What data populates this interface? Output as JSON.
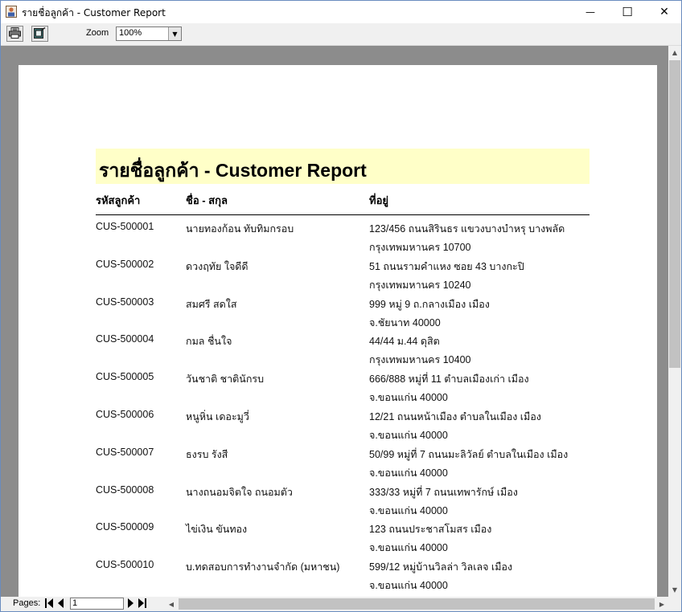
{
  "window": {
    "title": "รายชื่อลูกค้า - Customer Report",
    "icon": "report-app-icon",
    "controls": {
      "minimize": "—",
      "maximize": "☐",
      "close": "✕"
    }
  },
  "toolbar": {
    "print_icon": "print-icon",
    "export_icon": "export-icon",
    "zoom_label": "Zoom",
    "zoom_value": "100%"
  },
  "report": {
    "title": "รายชื่อลูกค้า - Customer Report",
    "title_background": "#ffffc8",
    "columns": {
      "id": "รหัสลูกค้า",
      "name": "ชื่อ - สกุล",
      "address": "ที่อยู่"
    },
    "rows": [
      {
        "id": "CUS-500001",
        "name": "นายทองก้อน ทับทิมกรอบ",
        "addr1": "123/456 ถนนสิรินธร แขวงบางบำหรุ  บางพลัด",
        "addr2": "กรุงเทพมหานคร  10700"
      },
      {
        "id": "CUS-500002",
        "name": "ดวงฤทัย ใจดีดี",
        "addr1": "51 ถนนรามคำแหง ซอย 43  บางกะปิ",
        "addr2": "กรุงเทพมหานคร  10240"
      },
      {
        "id": "CUS-500003",
        "name": "สมศรี สดใส",
        "addr1": "999 หมู่ 9 ถ.กลางเมือง  เมือง",
        "addr2": "จ.ชัยนาท  40000"
      },
      {
        "id": "CUS-500004",
        "name": "กมล ชื่นใจ",
        "addr1": "44/44 ม.44  ดุสิต",
        "addr2": "กรุงเทพมหานคร  10400"
      },
      {
        "id": "CUS-500005",
        "name": "วันชาติ ชาตินักรบ",
        "addr1": "666/888 หมู่ที่ 11 ตำบลเมืองเก่า  เมือง",
        "addr2": "จ.ขอนแก่น  40000"
      },
      {
        "id": "CUS-500006",
        "name": "หนูหิ่น เดอะมูวี่",
        "addr1": "12/21 ถนนหน้าเมือง ตำบลในเมือง  เมือง",
        "addr2": "จ.ขอนแก่น  40000"
      },
      {
        "id": "CUS-500007",
        "name": "ธงรบ รังสี",
        "addr1": "50/99 หมู่ที่ 7 ถนนมะลิวัลย์ ตำบลในเมือง  เมือง",
        "addr2": "จ.ขอนแก่น  40000"
      },
      {
        "id": "CUS-500008",
        "name": "นางถนอมจิตใจ ถนอมตัว",
        "addr1": "333/33 หมู่ที่ 7 ถนนเทพารักษ์  เมือง",
        "addr2": "จ.ขอนแก่น  40000"
      },
      {
        "id": "CUS-500009",
        "name": "ไข่เงิน ขันทอง",
        "addr1": "123 ถนนประชาสโมสร  เมือง",
        "addr2": "จ.ขอนแก่น  40000"
      },
      {
        "id": "CUS-500010",
        "name": "บ.ทดสอบการทำงานจำกัด (มหาชน)",
        "addr1": "599/12 หมู่บ้านวิลล่า วิลเลจ  เมือง",
        "addr2": "จ.ขอนแก่น  40000"
      }
    ]
  },
  "statusbar": {
    "pages_label": "Pages:",
    "page_value": "1"
  }
}
